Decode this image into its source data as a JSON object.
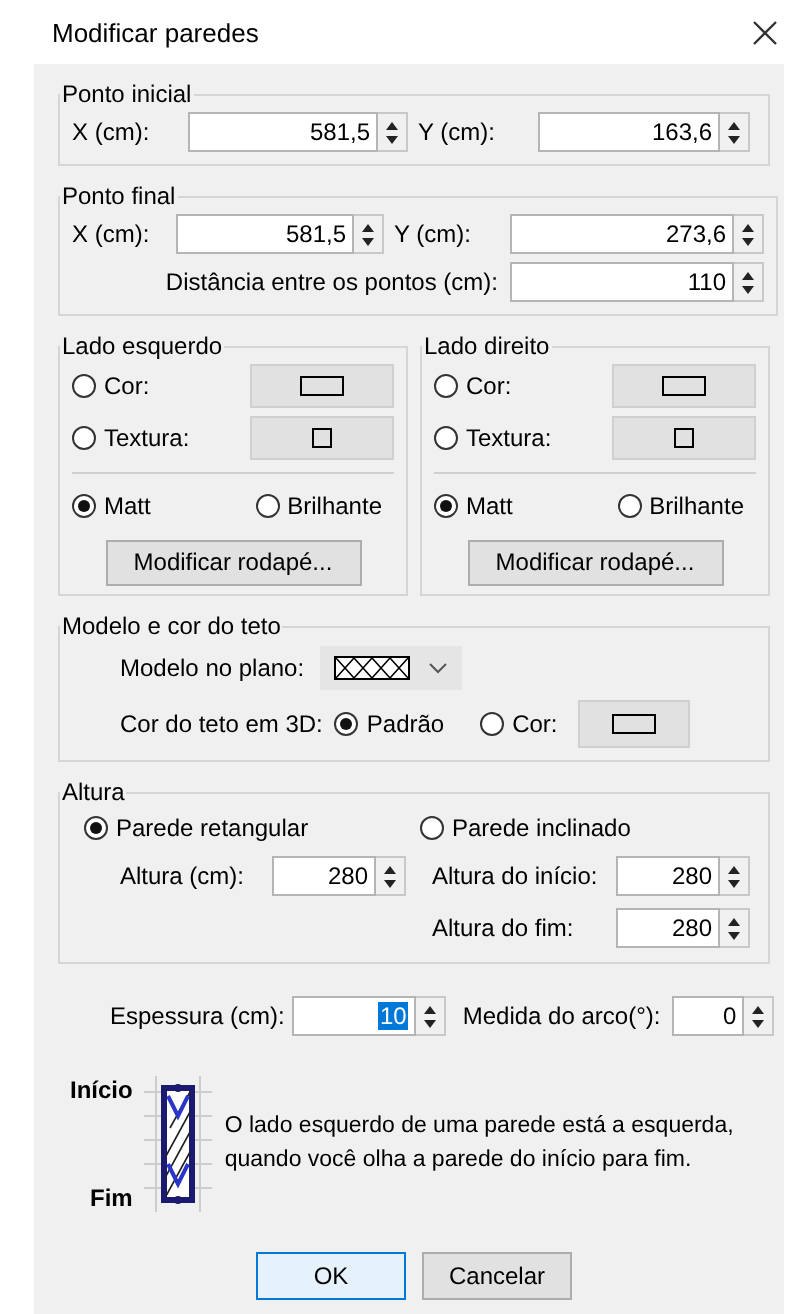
{
  "window": {
    "title": "Modificar paredes"
  },
  "start_point": {
    "title": "Ponto inicial",
    "fields": [
      {
        "label": "X (cm):",
        "value": "581,5"
      },
      {
        "label": "Y (cm):",
        "value": "163,6"
      }
    ]
  },
  "end_point": {
    "title": "Ponto final",
    "fields": [
      {
        "label": "X (cm):",
        "value": "581,5"
      },
      {
        "label": "Y (cm):",
        "value": "273,6"
      }
    ],
    "distance": {
      "label": "Distância entre os pontos (cm):",
      "value": "110"
    }
  },
  "sides": [
    {
      "title": "Lado esquerdo",
      "fill_options": [
        {
          "label": "Cor:",
          "selected": false,
          "kind": "color"
        },
        {
          "label": "Textura:",
          "selected": false,
          "kind": "texture"
        }
      ],
      "finish_options": [
        {
          "label": "Matt",
          "selected": true
        },
        {
          "label": "Brilhante",
          "selected": false
        }
      ],
      "button": "Modificar rodapé..."
    },
    {
      "title": "Lado direito",
      "fill_options": [
        {
          "label": "Cor:",
          "selected": false,
          "kind": "color"
        },
        {
          "label": "Textura:",
          "selected": false,
          "kind": "texture"
        }
      ],
      "finish_options": [
        {
          "label": "Matt",
          "selected": true
        },
        {
          "label": "Brilhante",
          "selected": false
        }
      ],
      "button": "Modificar rodapé..."
    }
  ],
  "ceiling": {
    "title": "Modelo e cor do teto",
    "model_label": "Modelo no plano:",
    "color_label": "Cor do teto em 3D:",
    "color_options": [
      {
        "label": "Padrão",
        "selected": true,
        "kind": "default"
      },
      {
        "label": "Cor:",
        "selected": false,
        "kind": "color"
      }
    ]
  },
  "height": {
    "title": "Altura",
    "modes": [
      {
        "label": "Parede retangular",
        "selected": true,
        "fields": [
          {
            "label": "Altura (cm):",
            "value": "280"
          }
        ]
      },
      {
        "label": "Parede inclinado",
        "selected": false,
        "fields": [
          {
            "label": "Altura do início:",
            "value": "280"
          },
          {
            "label": "Altura do fim:",
            "value": "280"
          }
        ]
      }
    ]
  },
  "thickness": {
    "label": "Espessura (cm):",
    "value": "10",
    "selected": true
  },
  "arc": {
    "label": "Medida do arco(°):",
    "value": "0"
  },
  "legend": {
    "start": "Início",
    "end": "Fim",
    "text": "O lado esquerdo de uma parede está a esquerda, quando você olha a parede do início para fim."
  },
  "buttons": [
    {
      "label": "OK",
      "focused": true
    },
    {
      "label": "Cancelar",
      "focused": false
    }
  ]
}
